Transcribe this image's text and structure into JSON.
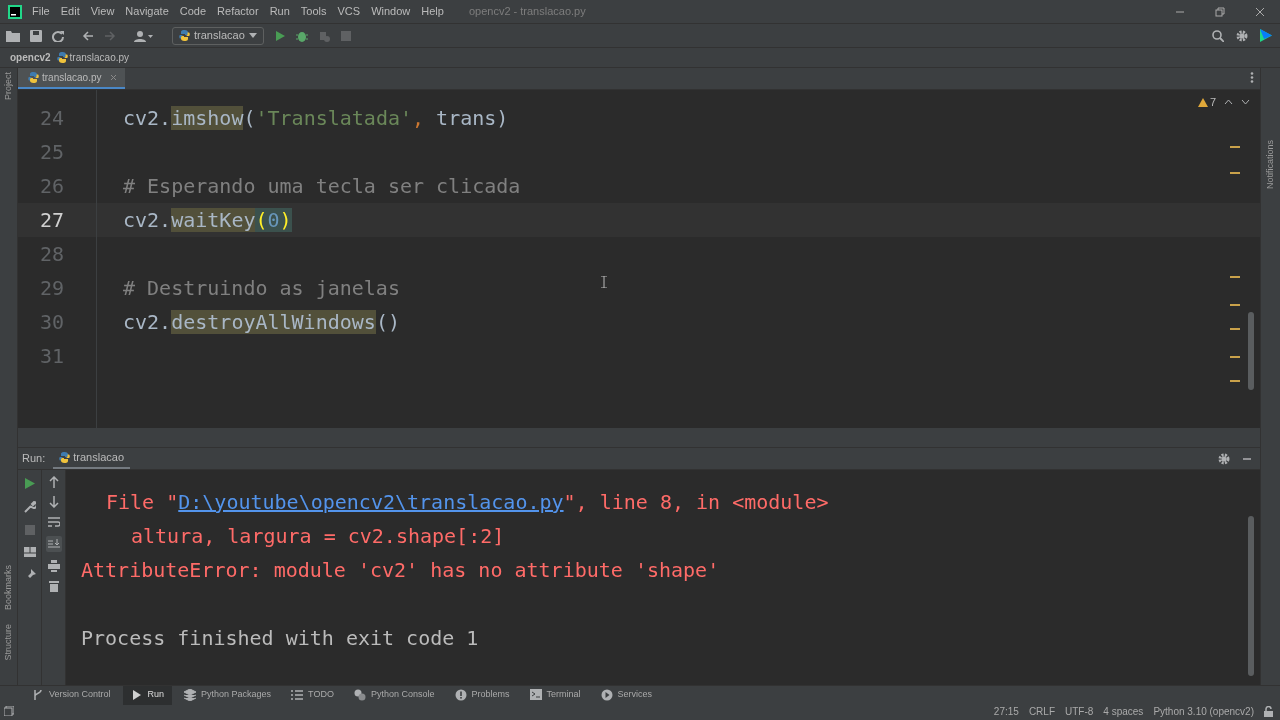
{
  "menu": [
    "File",
    "Edit",
    "View",
    "Navigate",
    "Code",
    "Refactor",
    "Run",
    "Tools",
    "VCS",
    "Window",
    "Help"
  ],
  "window": {
    "title": "opencv2 - translacao.py"
  },
  "toolbar": {
    "run_config": "translacao"
  },
  "breadcrumb": [
    "opencv2",
    "translacao.py"
  ],
  "editor_tabs": [
    {
      "label": "translacao.py",
      "selected": true
    }
  ],
  "inspections": {
    "warnings": "7"
  },
  "side_left": [
    "Project"
  ],
  "side_left_bottom": [
    "Bookmarks",
    "Structure"
  ],
  "side_right": [
    "Notifications"
  ],
  "code": [
    {
      "number": "24",
      "current": false,
      "tokens": [
        {
          "kind": "plain",
          "text": "cv2."
        },
        {
          "kind": "usage",
          "text": "imshow"
        },
        {
          "kind": "plain",
          "text": "("
        },
        {
          "kind": "string",
          "text": "'Translatada'"
        },
        {
          "kind": "punct",
          "text": ", "
        },
        {
          "kind": "plain",
          "text": "trans)"
        }
      ]
    },
    {
      "number": "25",
      "current": false
    },
    {
      "number": "26",
      "current": false,
      "tokens": [
        {
          "kind": "comment",
          "text": "# Esperando uma tecla ser clicada"
        }
      ]
    },
    {
      "number": "27",
      "current": true,
      "tokens": [
        {
          "kind": "plain",
          "text": "cv2."
        },
        {
          "kind": "usage",
          "text": "waitKey"
        },
        {
          "kind": "brace",
          "text": "("
        },
        {
          "kind": "number",
          "text": "0"
        },
        {
          "kind": "brace",
          "text": ")"
        }
      ]
    },
    {
      "number": "28",
      "current": false
    },
    {
      "number": "29",
      "current": false,
      "tokens": [
        {
          "kind": "comment",
          "text": "# Destruindo as janelas"
        }
      ]
    },
    {
      "number": "30",
      "current": false,
      "tokens": [
        {
          "kind": "plain",
          "text": "cv2."
        },
        {
          "kind": "usage",
          "text": "destroyAllWindows"
        },
        {
          "kind": "plain",
          "text": "()"
        }
      ]
    },
    {
      "number": "31",
      "current": false
    }
  ],
  "run_panel": {
    "label": "Run:",
    "tabs": [
      {
        "label": "translacao",
        "selected": true
      }
    ]
  },
  "console": [
    {
      "kind": "trace",
      "parts": [
        {
          "kind": "text",
          "text": "File \""
        },
        {
          "kind": "link",
          "text": "D:\\youtube\\opencv2\\translacao.py"
        },
        {
          "kind": "text",
          "text": "\", line 8, in <module>"
        }
      ]
    },
    {
      "kind": "source",
      "parts": [
        {
          "kind": "text",
          "text": "altura, largura = cv2.shape[:2]"
        }
      ]
    },
    {
      "kind": "error",
      "parts": [
        {
          "kind": "text",
          "text": "AttributeError: module 'cv2' has no attribute 'shape'"
        }
      ]
    },
    {
      "kind": "blank"
    },
    {
      "kind": "normal",
      "parts": [
        {
          "kind": "text",
          "text": "Process finished with exit code 1"
        }
      ]
    }
  ],
  "tool_windows": [
    {
      "label": "Version Control",
      "selected": false
    },
    {
      "label": "Run",
      "selected": true
    },
    {
      "label": "Python Packages",
      "selected": false
    },
    {
      "label": "TODO",
      "selected": false
    },
    {
      "label": "Python Console",
      "selected": false
    },
    {
      "label": "Problems",
      "selected": false
    },
    {
      "label": "Terminal",
      "selected": false
    },
    {
      "label": "Services",
      "selected": false
    }
  ],
  "status_bar": [
    "27:15",
    "CRLF",
    "UTF-8",
    "4 spaces",
    "Python 3.10 (opencv2)"
  ]
}
